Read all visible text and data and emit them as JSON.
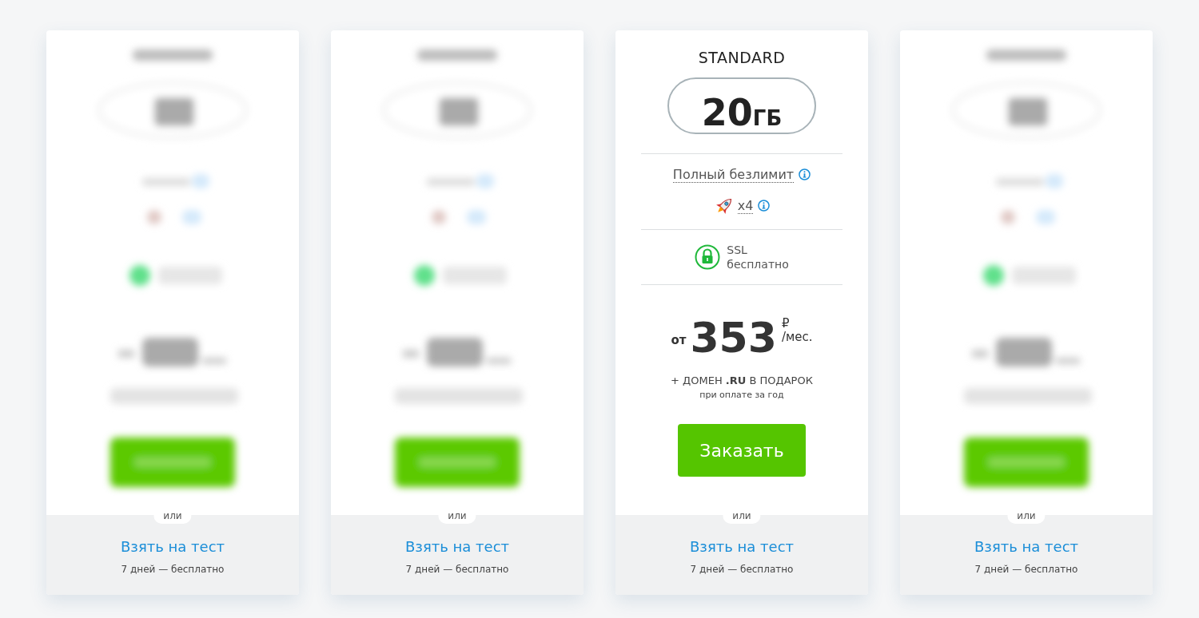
{
  "plans": [
    {
      "kind": "blurred",
      "separator": "или",
      "trial_link": "Взять на тест",
      "trial_note": "7 дней — бесплатно"
    },
    {
      "kind": "blurred",
      "separator": "или",
      "trial_link": "Взять на тест",
      "trial_note": "7 дней — бесплатно"
    },
    {
      "kind": "detailed",
      "name": "STANDARD",
      "disk_amount": "20",
      "disk_unit": "ГБ",
      "traffic": "Полный безлимит",
      "speed": "x4",
      "ssl_title": "SSL",
      "ssl_note": "бесплатно",
      "price_prefix": "от",
      "price": "353",
      "currency": "₽",
      "period": "/мес.",
      "bonus": "+ ДОМЕН **.RU** В ПОДАРОК",
      "bonus_note": "при оплате за год",
      "order_button": "Заказать",
      "separator": "или",
      "trial_link": "Взять на тест",
      "trial_note": "7 дней — бесплатно"
    },
    {
      "kind": "blurred",
      "separator": "или",
      "trial_link": "Взять на тест",
      "trial_note": "7 дней — бесплатно"
    }
  ]
}
